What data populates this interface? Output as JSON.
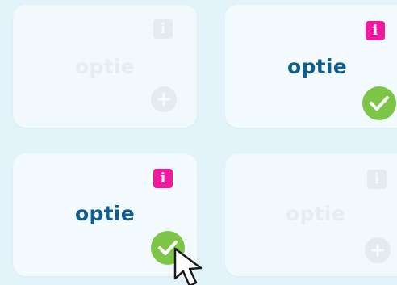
{
  "options": [
    {
      "label": "optie",
      "selected": false,
      "info_icon": "info-icon",
      "status_icon": "plus-icon"
    },
    {
      "label": "optie",
      "selected": true,
      "info_icon": "info-icon",
      "status_icon": "checkmark-icon"
    },
    {
      "label": "optie",
      "selected": true,
      "info_icon": "info-icon",
      "status_icon": "checkmark-icon"
    },
    {
      "label": "optie",
      "selected": false,
      "info_icon": "info-icon",
      "status_icon": "plus-icon"
    }
  ],
  "info_glyph": "i",
  "colors": {
    "background": "#e3f3fa",
    "card": "#f4fbfe",
    "accent_info": "#f01aa0",
    "label_active": "#0f5e8c",
    "check_green": "#7cc547",
    "inactive_grey": "#e4eaed"
  },
  "pointer_icon": "mouse-pointer-icon"
}
